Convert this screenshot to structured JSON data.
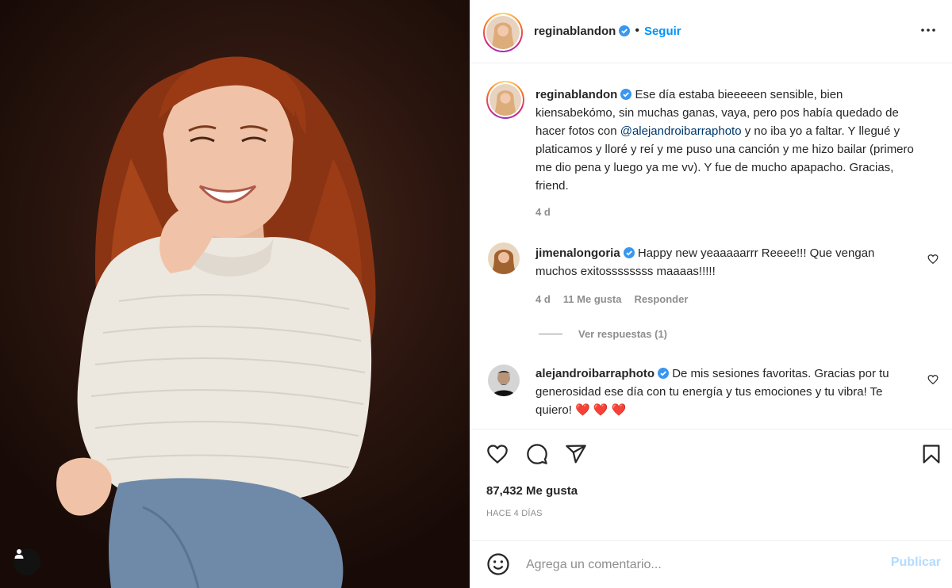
{
  "post": {
    "author": "reginablandon",
    "follow_label": "Seguir",
    "dot": "•",
    "more_icon": "more-horizontal-icon"
  },
  "caption": {
    "author": "reginablandon",
    "text_before": "Ese día estaba bieeeeen sensible, bien kiensabekómo, sin muchas ganas, vaya, pero pos había quedado de hacer fotos con ",
    "mention": "@alejandroibarraphoto",
    "text_after": " y no iba yo a faltar. Y llegué y platicamos y lloré y reí y me puso una canción y me hizo bailar (primero me dio pena y luego ya me vv). Y fue de mucho apapacho. Gracias, friend.",
    "age": "4 d"
  },
  "comments": [
    {
      "author": "jimenalongoria",
      "text": "Happy new yeaaaaarrr Reeee!!! Que vengan muchos exitossssssss maaaas!!!!!",
      "age": "4 d",
      "likes": "11 Me gusta",
      "reply_label": "Responder",
      "view_replies": "Ver respuestas (1)"
    },
    {
      "author": "alejandroibarraphoto",
      "text": "De mis sesiones favoritas. Gracias por tu generosidad ese día con tu energía y tus emociones y tu vibra! Te quiero! ",
      "hearts": "❤️ ❤️ ❤️"
    }
  ],
  "stats": {
    "likes": "87,432 Me gusta",
    "date": "HACE 4 DÍAS"
  },
  "composer": {
    "placeholder": "Agrega un comentario...",
    "publish_label": "Publicar"
  },
  "colors": {
    "accent": "#0095f6",
    "verified": "#3897f0",
    "mention": "#00376b",
    "muted": "#8e8e8e",
    "heart": "#ed4956"
  }
}
